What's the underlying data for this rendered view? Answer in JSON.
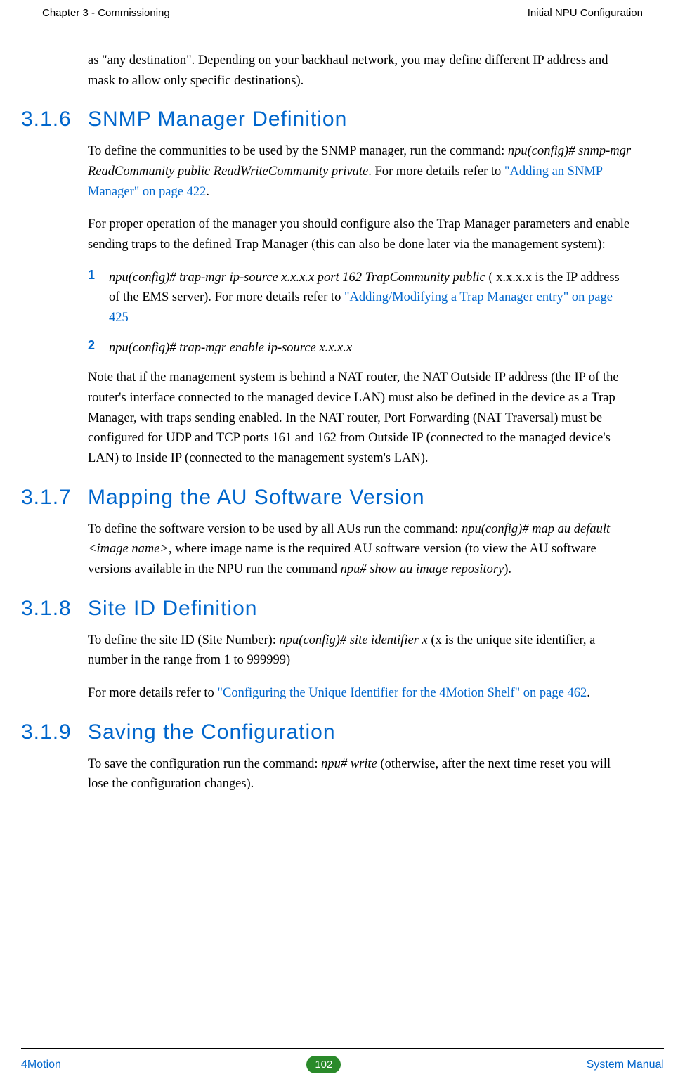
{
  "header": {
    "left": "Chapter 3 - Commissioning",
    "right": "Initial NPU Configuration"
  },
  "intro": {
    "p1a": "as \"any destination\". Depending on your backhaul network, you may define different IP address and mask to allow only specific destinations)."
  },
  "s316": {
    "num": "3.1.6",
    "title": "SNMP Manager Definition",
    "p1a": "To define the communities to be used by the SNMP manager, run the command: ",
    "p1b": "npu(config)# snmp-mgr ReadCommunity public ReadWriteCommunity private",
    "p1c": ". For more details refer to ",
    "p1link": "\"Adding an SNMP Manager\" on page 422",
    "p1d": ".",
    "p2": "For proper operation of the manager you should configure also the Trap Manager parameters and enable sending traps to the defined Trap Manager (this can also be done later via the management system):",
    "li1num": "1",
    "li1a": "npu(config)# trap-mgr ip-source x.x.x.x port 162 TrapCommunity public",
    "li1b": " ( x.x.x.x is the IP address of the EMS server). For more details refer to ",
    "li1link": "\"Adding/Modifying a Trap Manager entry\" on page 425",
    "li2num": "2",
    "li2a": "npu(config)# trap-mgr enable ip-source x.x.x.x",
    "p3": "Note that if the management system is behind a NAT router, the NAT Outside IP address (the IP of the router's interface connected to the managed device LAN) must also be defined in the device as a Trap Manager, with traps sending enabled. In the NAT router, Port Forwarding (NAT Traversal) must be configured for UDP and TCP ports 161 and 162 from Outside IP (connected to the managed device's LAN) to Inside IP (connected to the management system's LAN)."
  },
  "s317": {
    "num": "3.1.7",
    "title": "Mapping the AU Software Version",
    "p1a": "To define the software version to be used by all AUs run the command: ",
    "p1b": "npu(config)# map au default <image name>",
    "p1c": ", where image name is the required AU software version (to view the AU software versions available in the NPU run the command ",
    "p1d": "npu# show au image repository",
    "p1e": ")."
  },
  "s318": {
    "num": "3.1.8",
    "title": "Site ID Definition",
    "p1a": "To define the site ID (Site Number): ",
    "p1b": "npu(config)# site identifier x",
    "p1c": " (x is the unique site identifier, a number in the range from 1 to 999999)",
    "p2a": "For more details refer to ",
    "p2link": "\"Configuring the Unique Identifier for the 4Motion Shelf\" on page 462",
    "p2b": "."
  },
  "s319": {
    "num": "3.1.9",
    "title": "Saving the Configuration",
    "p1a": "To save the configuration run the command: ",
    "p1b": "npu# write",
    "p1c": " (otherwise, after the next time reset you will lose the configuration changes)."
  },
  "footer": {
    "left": "4Motion",
    "page": "102",
    "right": "System Manual"
  }
}
